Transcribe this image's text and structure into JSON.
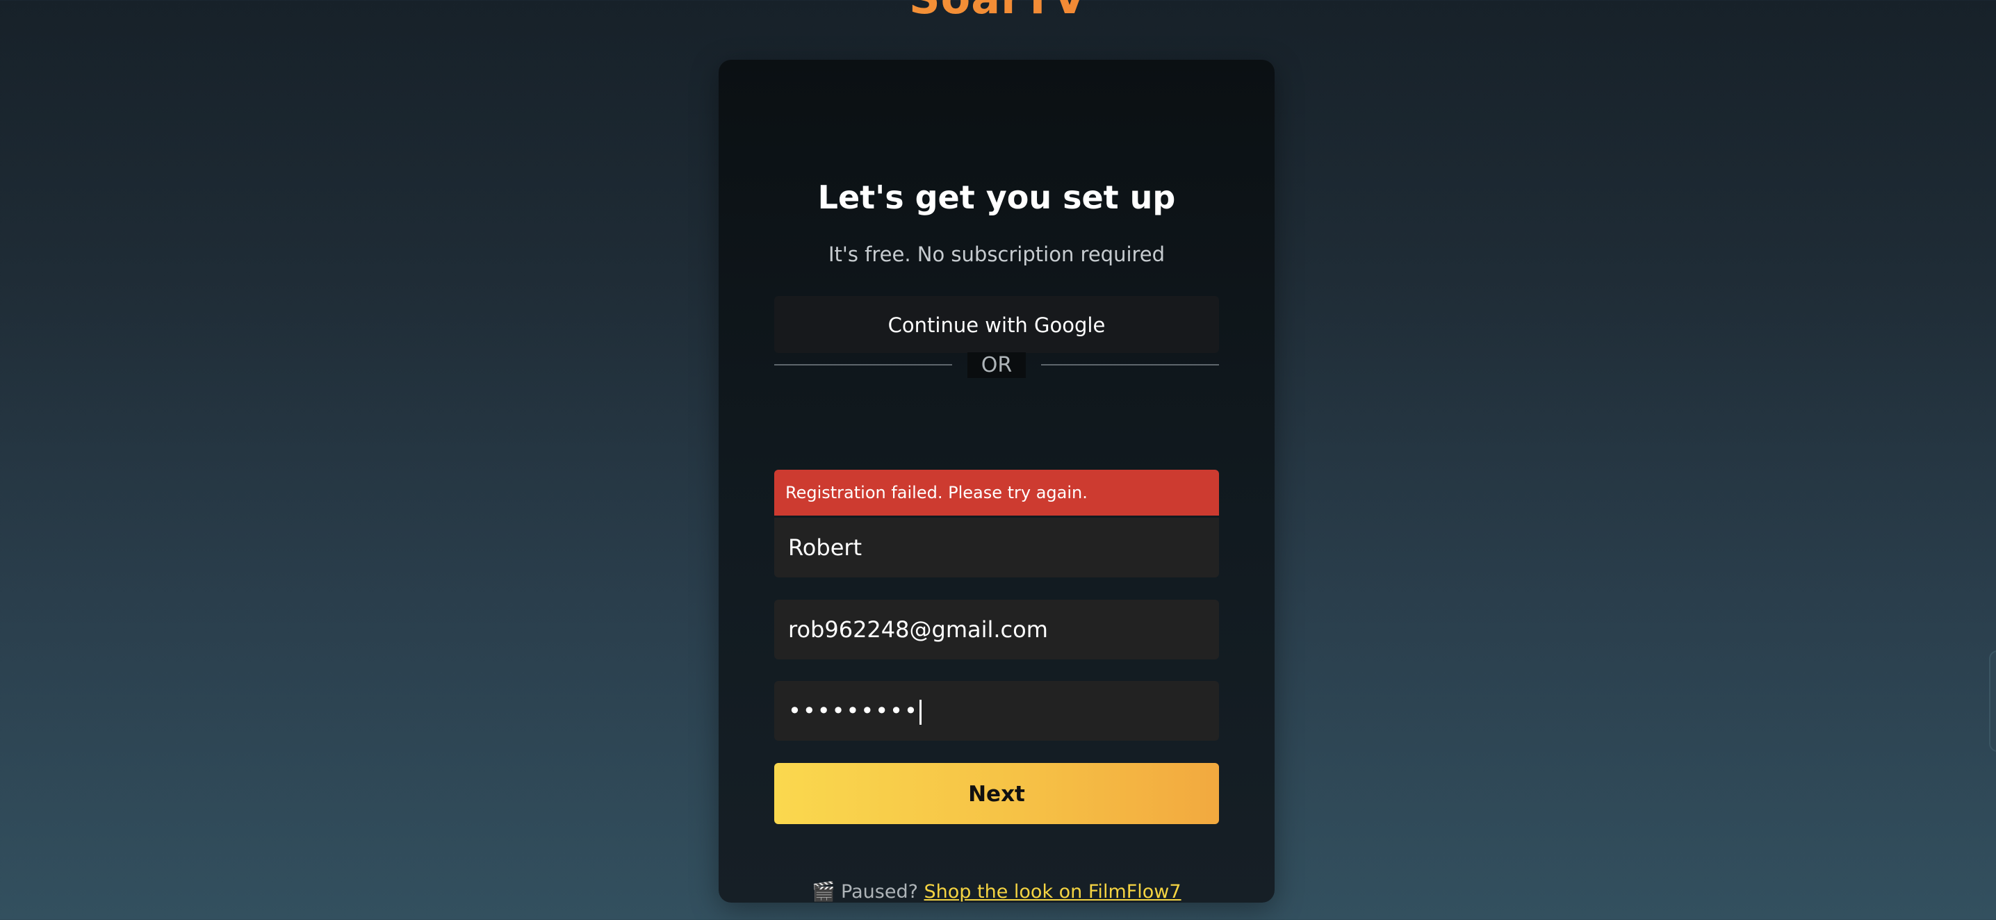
{
  "brand": {
    "name": "SoarTV"
  },
  "card": {
    "title": "Let's get you set up",
    "subtitle": "It's free. No subscription required",
    "google_button_label": "Continue with Google",
    "divider_label": "OR",
    "error_message": "Registration failed. Please try again.",
    "name_field": {
      "value": "Robert"
    },
    "email_field": {
      "value": "rob962248@gmail.com"
    },
    "password_field": {
      "masked_value": "•••••••••"
    },
    "next_button_label": "Next",
    "promo": {
      "icon": "🎬",
      "icon_name": "clapperboard-icon",
      "prefix": "Paused?",
      "link_text": "Shop the look on FilmFlow7",
      "link_color": "#f5d442"
    }
  },
  "colors": {
    "accent_yellow": "#fad84e",
    "accent_orange": "#f2a93f",
    "error_red": "#cd3b30",
    "brand_orange": "#ef6a2c"
  }
}
